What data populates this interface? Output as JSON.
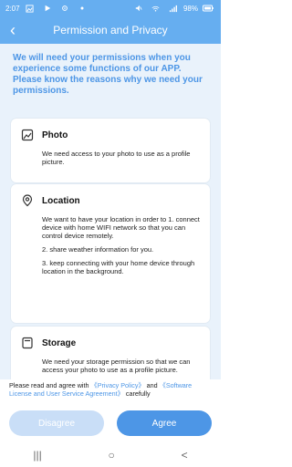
{
  "status_bar": {
    "time": "2:07",
    "left_icons": [
      "photo-icon",
      "play-icon",
      "settings-icon",
      "dot-icon"
    ],
    "right_text": "98%",
    "right_icons": [
      "mute-icon",
      "wifi-icon",
      "signal-icon",
      "battery-icon"
    ]
  },
  "header": {
    "title": "Permission and Privacy",
    "back_icon": "chevron-left-icon"
  },
  "intro": {
    "text": "We will need your permissions when you experience some functions of our APP. Please know the reasons why we need your permissions."
  },
  "sections": [
    {
      "title": "Photo",
      "icon": "photo-icon",
      "paragraphs": [
        "We need access to your photo to use as a profile picture."
      ]
    },
    {
      "title": "Location",
      "icon": "location-pin-icon",
      "paragraphs": [
        "We want to have your location in order to 1. connect device with home WIFI network so that you can control device remotely.",
        "2. share weather information for you.",
        "3. keep connecting with your home device through location in the background."
      ]
    },
    {
      "title": "Storage",
      "icon": "storage-icon",
      "paragraphs": [
        "We need your storage permission so that we can access your photo to use as a profile picture."
      ]
    }
  ],
  "consent": {
    "prefix": "Please read and agree with ",
    "privacy_policy": "《Privacy Policy》",
    "and_text": " and ",
    "software_license": "《Software License and User Service Agreement》",
    "suffix": " carefully"
  },
  "buttons": {
    "disagree": "Disagree",
    "agree": "Agree"
  },
  "nav": {
    "recents": "|||",
    "home": "○",
    "back": "<"
  },
  "colors": {
    "primary": "#66aef0",
    "accent": "#4d96e6",
    "background": "#e9f2fb",
    "disabled_button": "#c9def7"
  }
}
